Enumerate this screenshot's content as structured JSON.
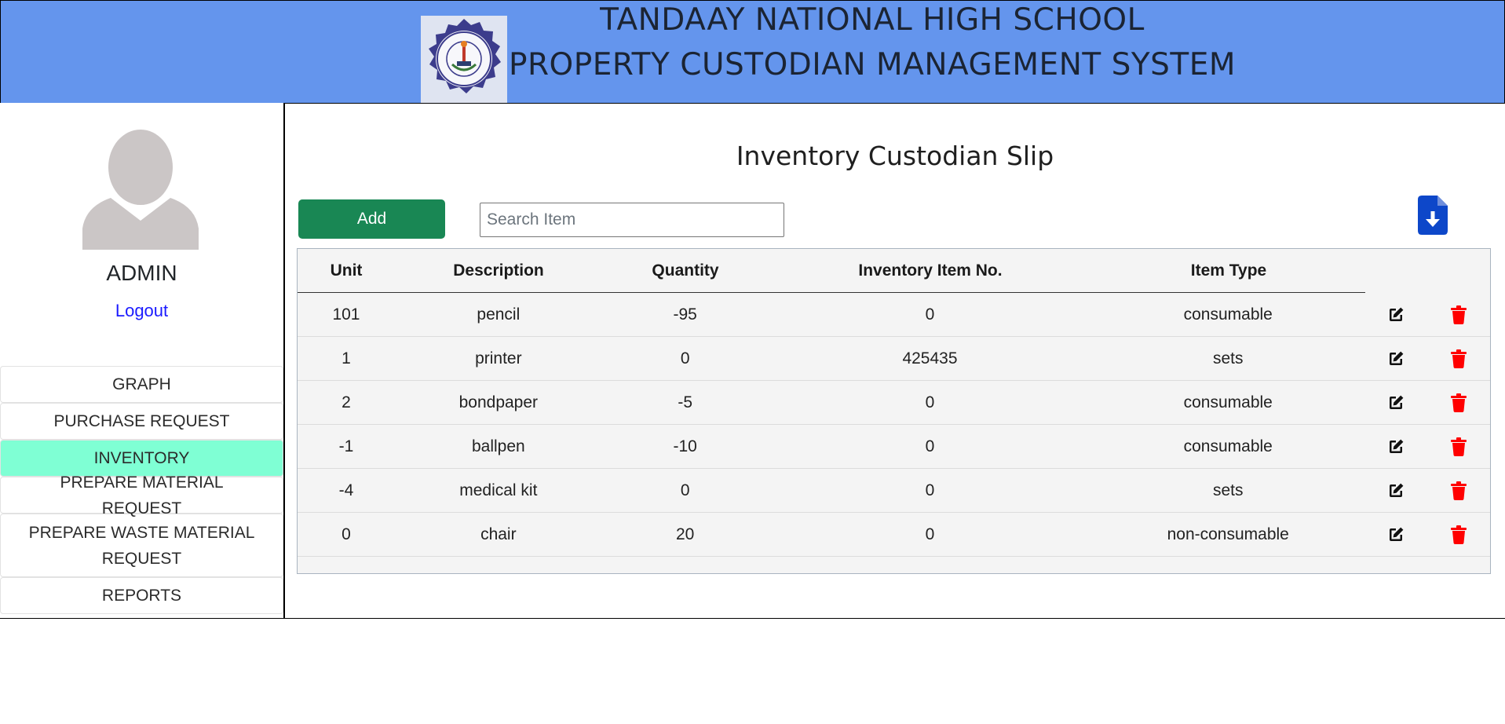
{
  "header": {
    "title_line1": "TANDAAY NATIONAL HIGH SCHOOL",
    "title_line2": "PROPERTY CUSTODIAN MANAGEMENT SYSTEM",
    "logo_icon": "school-seal-icon",
    "colors": {
      "background": "#6495ed",
      "text": "#1b2433"
    }
  },
  "sidebar": {
    "user_name": "ADMIN",
    "logout_label": "Logout",
    "items": [
      {
        "label": "GRAPH"
      },
      {
        "label": "PURCHASE REQUEST"
      },
      {
        "label": "INVENTORY",
        "active": true
      },
      {
        "label": "PREPARE MATERIAL REQUEST"
      },
      {
        "label": "PREPARE WASTE MATERIAL REQUEST"
      },
      {
        "label": "REPORTS"
      }
    ],
    "colors": {
      "active": "#7fffd4",
      "logout": "#1a1aff"
    }
  },
  "main": {
    "page_title": "Inventory Custodian Slip",
    "add_label": "Add",
    "search_placeholder": "Search Item",
    "search_value": "",
    "download_icon": "file-download-icon",
    "colors": {
      "add_button": "#198754",
      "download": "#0d47c9",
      "delete": "#ff0000"
    },
    "table": {
      "headers": [
        "Unit",
        "Description",
        "Quantity",
        "Inventory Item No.",
        "Item Type"
      ],
      "rows": [
        [
          "101",
          "pencil",
          "-95",
          "0",
          "consumable"
        ],
        [
          "1",
          "printer",
          "0",
          "425435",
          "sets"
        ],
        [
          "2",
          "bondpaper",
          "-5",
          "0",
          "consumable"
        ],
        [
          "-1",
          "ballpen",
          "-10",
          "0",
          "consumable"
        ],
        [
          "-4",
          "medical kit",
          "0",
          "0",
          "sets"
        ],
        [
          "0",
          "chair",
          "20",
          "0",
          "non-consumable"
        ]
      ],
      "row_actions": [
        "edit-icon",
        "trash-icon"
      ]
    }
  }
}
